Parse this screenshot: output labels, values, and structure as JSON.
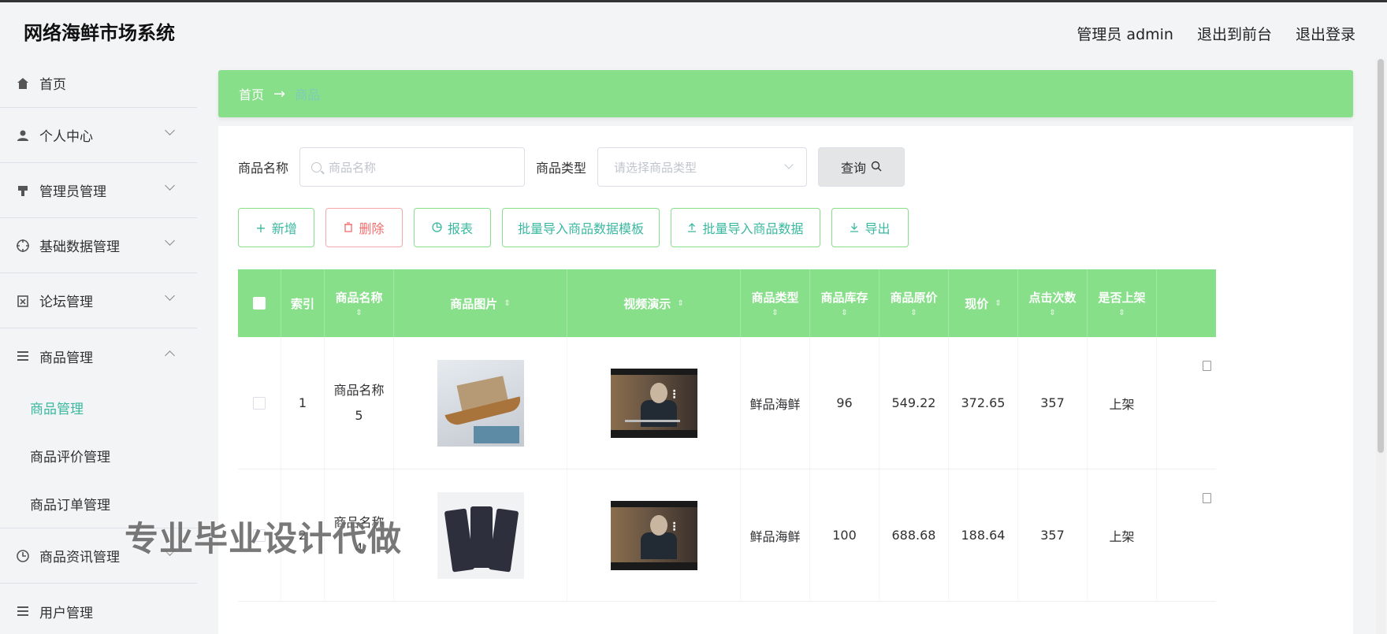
{
  "app": {
    "title": "网络海鲜市场系统"
  },
  "header": {
    "user": "管理员 admin",
    "to_front": "退出到前台",
    "logout": "退出登录"
  },
  "sidebar": {
    "items": [
      {
        "label": "首页",
        "icon": "home-icon"
      },
      {
        "label": "个人中心",
        "icon": "user-icon"
      },
      {
        "label": "管理员管理",
        "icon": "pin-icon"
      },
      {
        "label": "基础数据管理",
        "icon": "crosshair-icon"
      },
      {
        "label": "论坛管理",
        "icon": "clipboard-icon"
      },
      {
        "label": "商品管理",
        "icon": "menu-icon"
      },
      {
        "label": "商品资讯管理",
        "icon": "clock-icon"
      },
      {
        "label": "用户管理",
        "icon": "menu-icon"
      }
    ],
    "sub_items": [
      {
        "label": "商品管理",
        "active": true
      },
      {
        "label": "商品评价管理",
        "active": false
      },
      {
        "label": "商品订单管理",
        "active": false
      }
    ]
  },
  "breadcrumb": {
    "home": "首页",
    "separator": "→",
    "current": "商品"
  },
  "search": {
    "name_label": "商品名称",
    "name_placeholder": "商品名称",
    "type_label": "商品类型",
    "type_placeholder": "请选择商品类型",
    "query_button": "查询"
  },
  "actions": {
    "add": "新增",
    "delete": "删除",
    "report": "报表",
    "import_template": "批量导入商品数据模板",
    "import_data": "批量导入商品数据",
    "export": "导出"
  },
  "table": {
    "columns": [
      "索引",
      "商品名称",
      "商品图片",
      "视频演示",
      "商品类型",
      "商品库存",
      "商品原价",
      "现价",
      "点击次数",
      "是否上架"
    ],
    "rows": [
      {
        "index": "1",
        "name_line1": "商品名称",
        "name_line2": "5",
        "type": "鲜品海鲜",
        "stock": "96",
        "original_price": "549.22",
        "price": "372.65",
        "clicks": "357",
        "on_shelf": "上架"
      },
      {
        "index": "2",
        "name_line1": "商品名称",
        "name_line2": "4",
        "type": "鲜品海鲜",
        "stock": "100",
        "original_price": "688.68",
        "price": "188.64",
        "clicks": "357",
        "on_shelf": "上架"
      }
    ]
  },
  "watermark": "专业毕业设计代做",
  "colors": {
    "accent_green": "#88df8a",
    "teal_text": "#3ab8a0",
    "danger": "#f56c6c"
  }
}
